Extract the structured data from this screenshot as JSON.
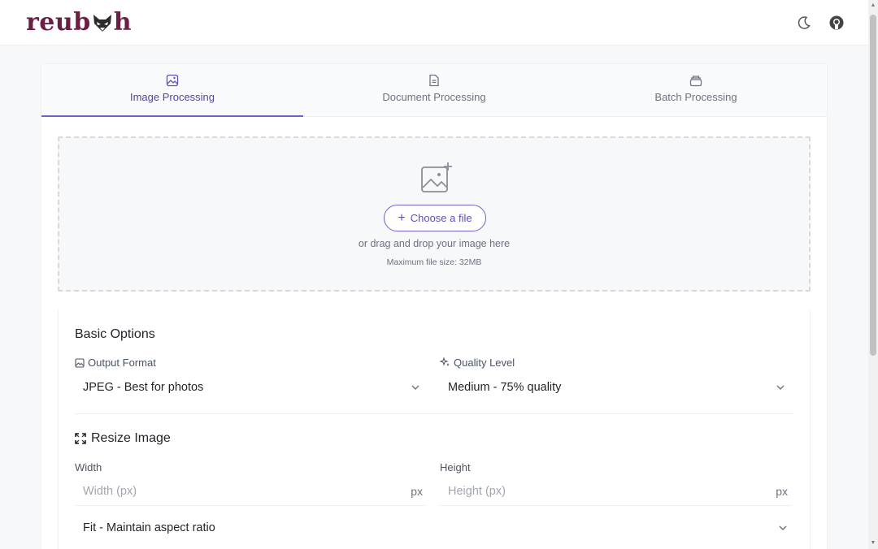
{
  "header": {
    "logo_text": "reub",
    "logo_text_end": "h",
    "icons": [
      "moon-icon",
      "github-icon"
    ]
  },
  "tabs": [
    {
      "label": "Image Processing",
      "icon": "image-icon",
      "active": true
    },
    {
      "label": "Document Processing",
      "icon": "document-icon",
      "active": false
    },
    {
      "label": "Batch Processing",
      "icon": "stack-icon",
      "active": false
    }
  ],
  "dropzone": {
    "choose_label": "Choose a file",
    "drag_text": "or drag and drop your image here",
    "max_size": "Maximum file size: 32MB"
  },
  "basic": {
    "title": "Basic Options",
    "format_label": "Output Format",
    "format_value": "JPEG - Best for photos",
    "quality_label": "Quality Level",
    "quality_value": "Medium - 75% quality"
  },
  "resize": {
    "title": "Resize Image",
    "width_label": "Width",
    "width_placeholder": "Width (px)",
    "height_label": "Height",
    "height_placeholder": "Height (px)",
    "unit": "px",
    "fit_value": "Fit - Maintain aspect ratio"
  },
  "colors": {
    "accent": "#6e63c7",
    "logo": "#6b1f45"
  }
}
